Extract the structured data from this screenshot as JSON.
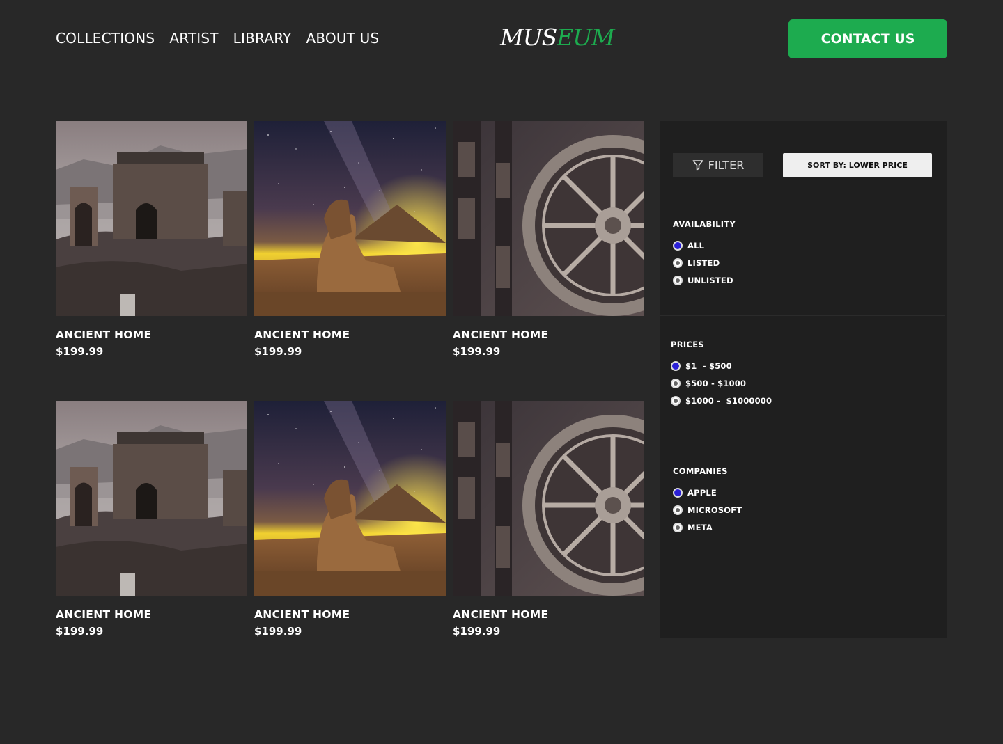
{
  "nav": {
    "items": [
      "COLLECTIONS",
      "ARTIST",
      "LIBRARY",
      "ABOUT US"
    ]
  },
  "logo": {
    "part1": "MUS",
    "part2": "EUM"
  },
  "header": {
    "contact_label": "CONTACT US"
  },
  "colors": {
    "accent": "#1dab4f",
    "background": "#282828",
    "panel": "#1f1f1f",
    "radio_selected": "#2a1fd6"
  },
  "products": [
    {
      "title": "ANCIENT HOME",
      "price": "$199.99",
      "image": "ruins"
    },
    {
      "title": "ANCIENT HOME",
      "price": "$199.99",
      "image": "sphinx"
    },
    {
      "title": "ANCIENT HOME",
      "price": "$199.99",
      "image": "wheel"
    },
    {
      "title": "ANCIENT HOME",
      "price": "$199.99",
      "image": "ruins"
    },
    {
      "title": "ANCIENT HOME",
      "price": "$199.99",
      "image": "sphinx"
    },
    {
      "title": "ANCIENT HOME",
      "price": "$199.99",
      "image": "wheel"
    }
  ],
  "panel": {
    "filter_label": "FILTER",
    "sort_label": "SORT BY: LOWER PRICE",
    "availability": {
      "title": "AVAILABILITY",
      "options": [
        "ALL",
        "LISTED",
        "UNLISTED"
      ],
      "selected": 0
    },
    "prices": {
      "title": "PRICES",
      "options": [
        "$1  - $500",
        "$500 - $1000",
        "$1000 -  $1000000"
      ],
      "selected": 0
    },
    "companies": {
      "title": "COMPANIES",
      "options": [
        "APPLE",
        "MICROSOFT",
        "META"
      ],
      "selected": 0
    }
  }
}
